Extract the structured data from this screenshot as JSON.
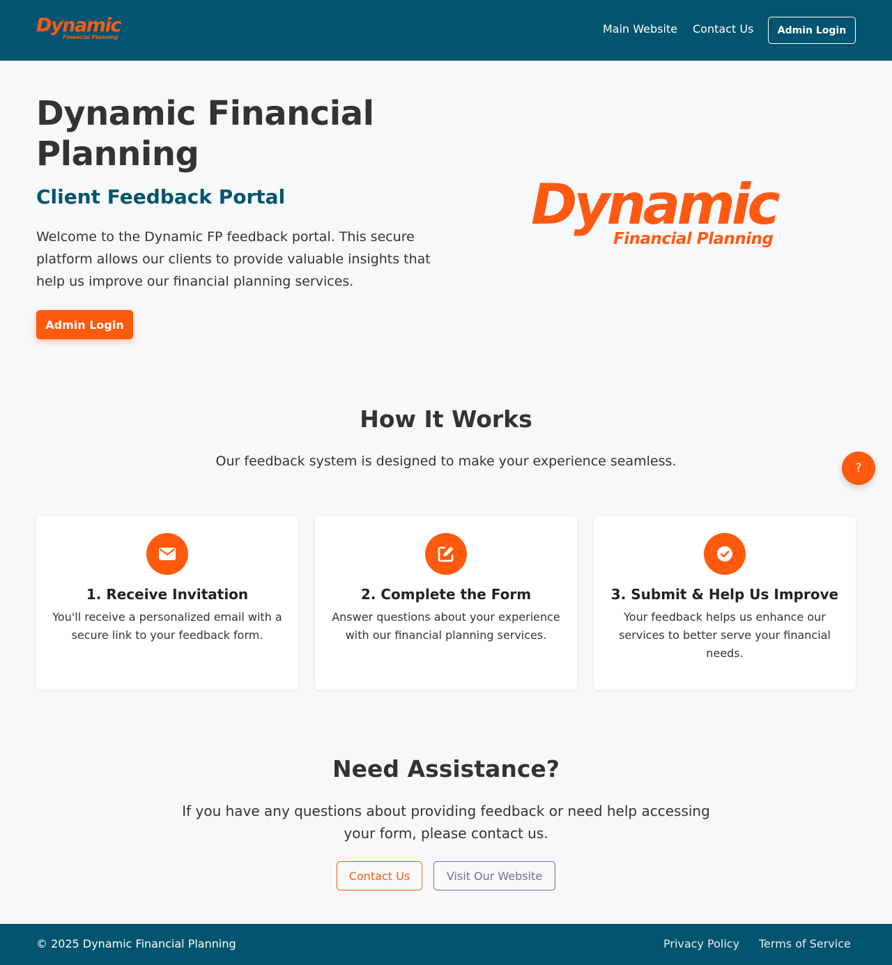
{
  "header": {
    "logo": {
      "word": "Dynamic",
      "tagline": "Financial Planning"
    },
    "nav": {
      "main_website": "Main Website",
      "contact_us": "Contact Us",
      "admin_login": "Admin Login"
    }
  },
  "hero": {
    "title": "Dynamic Financial Planning",
    "subtitle": "Client Feedback Portal",
    "description": "Welcome to the Dynamic FP feedback portal. This secure platform allows our clients to provide valuable insights that help us improve our financial planning services.",
    "button_label": "Admin Login",
    "logo": {
      "word": "Dynamic",
      "tagline": "Financial Planning"
    }
  },
  "how_it_works": {
    "title": "How It Works",
    "subtitle": "Our feedback system is designed to make your experience seamless.",
    "steps": [
      {
        "icon": "envelope-icon",
        "title": "1. Receive Invitation",
        "text": "You'll receive a personalized email with a secure link to your feedback form."
      },
      {
        "icon": "edit-icon",
        "title": "2. Complete the Form",
        "text": "Answer questions about your experience with our financial planning services."
      },
      {
        "icon": "check-circle-icon",
        "title": "3. Submit & Help Us Improve",
        "text": "Your feedback helps us enhance our services to better serve your financial needs."
      }
    ]
  },
  "help_button": {
    "label": "?"
  },
  "assistance": {
    "title": "Need Assistance?",
    "text": "If you have any questions about providing feedback or need help accessing your form, please contact us.",
    "contact_label": "Contact Us",
    "visit_label": "Visit Our Website"
  },
  "footer": {
    "copyright": "© 2025 Dynamic Financial Planning",
    "privacy": "Privacy Policy",
    "terms": "Terms of Service"
  },
  "colors": {
    "primary_teal": "#03546e",
    "accent_orange": "#ff5a0d",
    "background": "#f7f8fa",
    "secondary_gray": "#6c757d"
  }
}
